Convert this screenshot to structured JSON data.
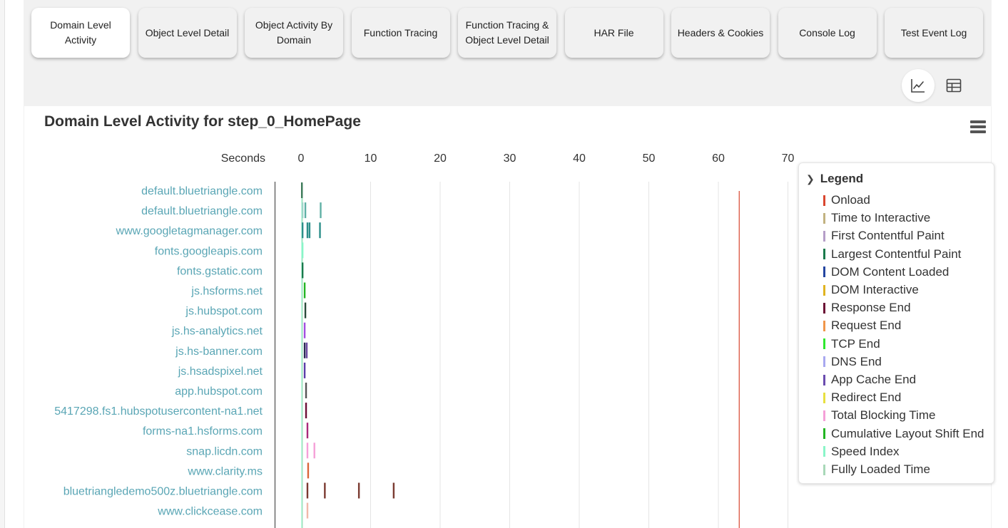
{
  "tabs": [
    {
      "label": "Domain Level Activity",
      "active": true
    },
    {
      "label": "Object Level Detail",
      "active": false
    },
    {
      "label": "Object Activity By Domain",
      "active": false
    },
    {
      "label": "Function Tracing",
      "active": false
    },
    {
      "label": "Function Tracing & Object Level Detail",
      "active": false
    },
    {
      "label": "HAR File",
      "active": false
    },
    {
      "label": "Headers & Cookies",
      "active": false
    },
    {
      "label": "Console Log",
      "active": false
    },
    {
      "label": "Test Event Log",
      "active": false
    }
  ],
  "view_toggle": {
    "icons": [
      "line-chart-icon",
      "table-icon"
    ],
    "active": "line-chart-icon"
  },
  "colors": {
    "domain_label": "#5aa6b5",
    "grid": "#e4e4e4",
    "axis": "#333333"
  },
  "chart_data": {
    "type": "timeline",
    "title": "Domain Level Activity for step_0_HomePage",
    "x_axis_label": "Seconds",
    "xlim": [
      0,
      70
    ],
    "x_ticks": [
      0,
      10,
      20,
      30,
      40,
      50,
      60,
      70
    ],
    "grid": true,
    "legend_position": "right",
    "legend_title": "Legend",
    "legend": [
      {
        "name": "Onload",
        "color": "#d9462f"
      },
      {
        "name": "Time to Interactive",
        "color": "#c2b280"
      },
      {
        "name": "First Contentful Paint",
        "color": "#b59ec8"
      },
      {
        "name": "Largest Contentful Paint",
        "color": "#1a7a4c"
      },
      {
        "name": "DOM Content Loaded",
        "color": "#2445a0"
      },
      {
        "name": "DOM Interactive",
        "color": "#e0b320"
      },
      {
        "name": "Response End",
        "color": "#6b0f35"
      },
      {
        "name": "Request End",
        "color": "#f0964a"
      },
      {
        "name": "TCP End",
        "color": "#2ee82e"
      },
      {
        "name": "DNS End",
        "color": "#a8a8f0"
      },
      {
        "name": "App Cache End",
        "color": "#6a4caf"
      },
      {
        "name": "Redirect End",
        "color": "#e8e040"
      },
      {
        "name": "Total Blocking Time",
        "color": "#f5a0d8"
      },
      {
        "name": "Cumulative Layout Shift End",
        "color": "#22b522"
      },
      {
        "name": "Speed Index",
        "color": "#8af5c8"
      },
      {
        "name": "Fully Loaded Time",
        "color": "#a8d8b8"
      }
    ],
    "onload_marker": {
      "x": 63,
      "color": "#d9462f"
    },
    "reference_lines": [
      {
        "x": 0.1,
        "color": "#8af5c8"
      },
      {
        "x": 0.2,
        "color": "#a8d8b8"
      }
    ],
    "rows": [
      {
        "domain": "default.bluetriangle.com",
        "marks": [
          {
            "x": 0.1,
            "color": "#3d7a5a"
          }
        ]
      },
      {
        "domain": "default.bluetriangle.com",
        "marks": [
          {
            "x": 0.2,
            "color": "#9ed6c8"
          },
          {
            "x": 0.6,
            "color": "#5fb0a5"
          },
          {
            "x": 2.8,
            "color": "#5fb0a5"
          }
        ]
      },
      {
        "domain": "www.googletagmanager.com",
        "marks": [
          {
            "x": 0.2,
            "color": "#2d8f8a"
          },
          {
            "x": 0.9,
            "color": "#2d8f8a"
          },
          {
            "x": 1.2,
            "color": "#2d8f8a"
          },
          {
            "x": 2.7,
            "color": "#2d8f8a"
          }
        ]
      },
      {
        "domain": "fonts.googleapis.com",
        "marks": [
          {
            "x": 0.2,
            "color": "#8af5c8"
          }
        ]
      },
      {
        "domain": "fonts.gstatic.com",
        "marks": [
          {
            "x": 0.2,
            "color": "#1a7a4c"
          }
        ]
      },
      {
        "domain": "js.hsforms.net",
        "marks": [
          {
            "x": 0.5,
            "color": "#22b522"
          }
        ]
      },
      {
        "domain": "js.hubspot.com",
        "marks": [
          {
            "x": 0.6,
            "color": "#2a4a3a"
          }
        ]
      },
      {
        "domain": "js.hs-analytics.net",
        "marks": [
          {
            "x": 0.5,
            "color": "#a24ee0"
          }
        ]
      },
      {
        "domain": "js.hs-banner.com",
        "marks": [
          {
            "x": 0.5,
            "color": "#2a2a55"
          },
          {
            "x": 0.8,
            "color": "#6b4aa0"
          }
        ]
      },
      {
        "domain": "js.hsadspixel.net",
        "marks": [
          {
            "x": 0.5,
            "color": "#5a3ca8"
          }
        ]
      },
      {
        "domain": "app.hubspot.com",
        "marks": [
          {
            "x": 0.7,
            "color": "#555555"
          }
        ]
      },
      {
        "domain": "5417298.fs1.hubspotusercontent-na1.net",
        "marks": [
          {
            "x": 0.7,
            "color": "#6b0f35"
          }
        ]
      },
      {
        "domain": "forms-na1.hsforms.com",
        "marks": [
          {
            "x": 0.9,
            "color": "#a82a7a"
          }
        ]
      },
      {
        "domain": "snap.licdn.com",
        "marks": [
          {
            "x": 0.9,
            "color": "#f5a0d8"
          },
          {
            "x": 1.9,
            "color": "#f5a0d8"
          }
        ]
      },
      {
        "domain": "www.clarity.ms",
        "marks": [
          {
            "x": 1.0,
            "color": "#d9663a"
          }
        ]
      },
      {
        "domain": "bluetriangledemo500z.bluetriangle.com",
        "marks": [
          {
            "x": 0.9,
            "color": "#7a3a30"
          },
          {
            "x": 3.4,
            "color": "#7a3a30"
          },
          {
            "x": 8.3,
            "color": "#7a3a30"
          },
          {
            "x": 13.3,
            "color": "#7a3a30"
          }
        ]
      },
      {
        "domain": "www.clickcease.com",
        "marks": [
          {
            "x": 0.9,
            "color": "#f0b8a8"
          }
        ]
      }
    ]
  }
}
